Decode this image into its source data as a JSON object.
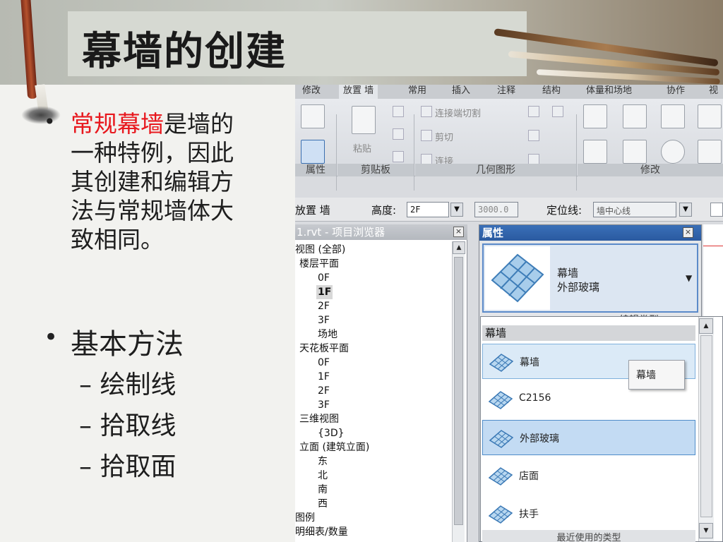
{
  "slide": {
    "title": "幕墙的创建",
    "bullet1_highlight": "常规幕墙",
    "bullet1_rest": "是墙的一种特例，因此其创建和编辑方法与常规墙体大致相同。",
    "bullet2": "基本方法",
    "sub_items": [
      "– 绘制线",
      "– 拾取线",
      "– 拾取面"
    ]
  },
  "ribbon": {
    "tabs": [
      "修改",
      "放置 墙",
      "常用",
      "插入",
      "注释",
      "结构",
      "体量和场地",
      "协作",
      "视"
    ],
    "paste_label": "粘贴",
    "join_cut": "连接端切割",
    "cut": "剪切",
    "join": "连接",
    "panels": [
      "属性",
      "剪贴板",
      "几何图形",
      "修改"
    ]
  },
  "options_bar": {
    "mode": "放置 墙",
    "height_label": "高度:",
    "height_value": "2F",
    "height_number": "3000.0",
    "location_label": "定位线:",
    "location_value": "墙中心线"
  },
  "project_browser": {
    "title": "1.rvt - 项目浏览器",
    "tree": [
      "视图 (全部)",
      "楼层平面",
      "0F",
      "1F",
      "2F",
      "3F",
      "场地",
      "天花板平面",
      "0F",
      "1F",
      "2F",
      "3F",
      "三维视图",
      "{3D}",
      "立面 (建筑立面)",
      "东",
      "北",
      "南",
      "西",
      "图例",
      "明细表/数量"
    ]
  },
  "properties": {
    "title": "属性",
    "family": "幕墙",
    "type": "外部玻璃",
    "edit_type": "编辑类型"
  },
  "type_dropdown": {
    "header": "幕墙",
    "items": [
      "幕墙",
      "C2156",
      "外部玻璃",
      "店面",
      "扶手"
    ],
    "tooltip": "幕墙",
    "footer": "最近使用的类型"
  }
}
